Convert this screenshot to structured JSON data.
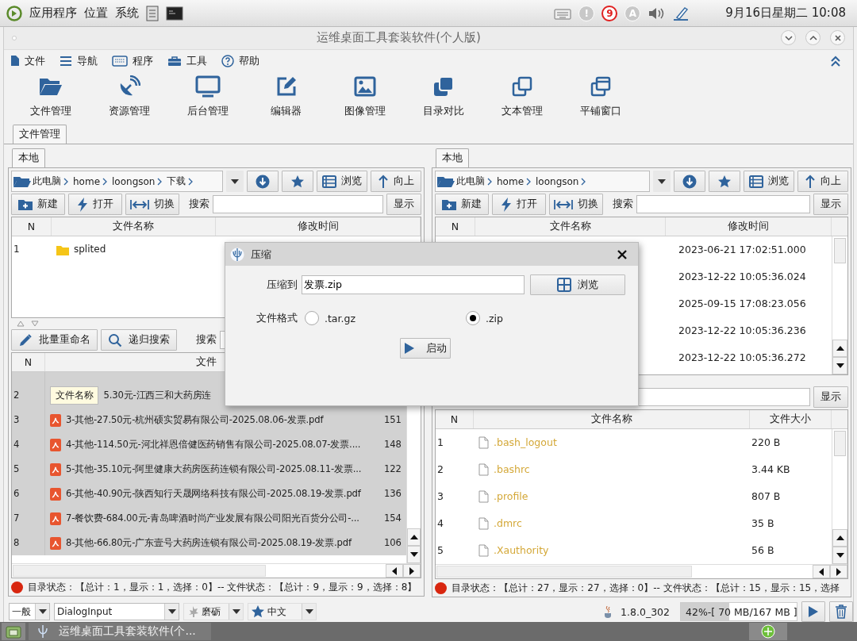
{
  "system_bar": {
    "menus": [
      "应用程序",
      "位置",
      "系统"
    ],
    "tray": [
      {
        "kind": "alert",
        "text": "!"
      },
      {
        "kind": "count",
        "text": "9"
      },
      {
        "kind": "letter",
        "text": "A"
      }
    ],
    "clock": "9月16日星期二 10:08"
  },
  "window": {
    "title": "运维桌面工具套装软件(个人版)"
  },
  "menu": [
    "文件",
    "导航",
    "程序",
    "工具",
    "帮助"
  ],
  "toolbar": [
    "文件管理",
    "资源管理",
    "后台管理",
    "编辑器",
    "图像管理",
    "目录对比",
    "文本管理",
    "平铺窗口"
  ],
  "tabs": [
    {
      "label": "文件管理",
      "selected": true
    }
  ],
  "panels": [
    {
      "tabs": [
        {
          "label": "本地",
          "selected": true
        }
      ],
      "path": [
        "此电脑",
        "home",
        "loongson",
        "下载"
      ],
      "browse": "浏览",
      "up": "向上",
      "actions": [
        "新建",
        "打开",
        "切换"
      ],
      "search_label": "搜索",
      "show": "显示",
      "dir_table": {
        "columns": [
          "N",
          "文件名称",
          "修改时间"
        ],
        "rows": [
          {
            "n": "1",
            "name": "splited",
            "selected": false
          }
        ]
      },
      "file_toolbar": {
        "actions": [
          "批量重命名",
          "递归搜索"
        ],
        "search_label": "搜索"
      },
      "file_table": {
        "columns": [
          "N",
          "文件"
        ],
        "rows": [
          {
            "selected": true
          },
          {
            "n": "2",
            "tooltip": "文件名称",
            "name": "5.30元-江西三和大药房连",
            "selected": true
          },
          {
            "n": "3",
            "name": "3-其他-27.50元-杭州硕实贸易有限公司-2025.08.06-发票.pdf",
            "size": "151",
            "selected": true
          },
          {
            "n": "4",
            "name": "4-其他-114.50元-河北祥恩倍健医药销售有限公司-2025.08.07-发票....",
            "size": "148",
            "selected": true
          },
          {
            "n": "5",
            "name": "5-其他-35.10元-阿里健康大药房医药连锁有限公司-2025.08.11-发票...",
            "size": "122",
            "selected": true
          },
          {
            "n": "6",
            "name": "6-其他-40.90元-陕西知行天晟网络科技有限公司-2025.08.19-发票.pdf",
            "size": "136",
            "selected": true
          },
          {
            "n": "7",
            "name": "7-餐饮费-684.00元-青岛啤酒时尚产业发展有限公司阳光百货分公司-...",
            "size": "154",
            "selected": true
          },
          {
            "n": "8",
            "name": "8-其他-66.80元-广东壹号大药房连锁有限公司-2025.08.19-发票.pdf",
            "size": "106",
            "selected": true
          }
        ]
      },
      "status": "目录状态：【总计：1，显示：1，选择：0】-- 文件状态：【总计：9，显示：9，选择：8】"
    },
    {
      "tabs": [
        {
          "label": "本地",
          "selected": true
        }
      ],
      "path": [
        "此电脑",
        "home",
        "loongson"
      ],
      "browse": "浏览",
      "up": "向上",
      "actions": [
        "新建",
        "打开",
        "切换"
      ],
      "search_label": "搜索",
      "show": "显示",
      "dir_table": {
        "columns": [
          "N",
          "文件名称",
          "修改时间"
        ],
        "rows": [
          {
            "modified": "2023-06-21 17:02:51.000",
            "selected": false
          },
          {
            "modified": "2023-12-22 10:05:36.024",
            "selected": false
          },
          {
            "modified": "2025-09-15 17:08:23.056",
            "selected": false
          },
          {
            "modified": "2023-12-22 10:05:36.236",
            "selected": false
          },
          {
            "modified": "2023-12-22 10:05:36.272",
            "selected": false
          }
        ]
      },
      "file_toolbar": {
        "show": "显示"
      },
      "file_table": {
        "columns": [
          "N",
          "文件名称",
          "文件大小"
        ],
        "rows": [
          {
            "n": "1",
            "name": ".bash_logout",
            "size": "220 B",
            "selected": false
          },
          {
            "n": "2",
            "name": ".bashrc",
            "size": "3.44 KB",
            "selected": false
          },
          {
            "n": "3",
            "name": ".profile",
            "size": "807 B",
            "selected": false
          },
          {
            "n": "4",
            "name": ".dmrc",
            "size": "35 B",
            "selected": false
          },
          {
            "n": "5",
            "name": ".Xauthority",
            "size": "56 B",
            "selected": false
          }
        ]
      },
      "status": "目录状态：【总计：27，显示：27，选择：0】-- 文件状态：【总计：15，显示：15，选择"
    }
  ],
  "dialog": {
    "title": "压缩",
    "target_label": "压缩到",
    "target_value": "发票.zip",
    "browse": "浏览",
    "format_label": "文件格式",
    "formats": [
      {
        "label": ".tar.gz",
        "selected": false
      },
      {
        "label": ".zip",
        "selected": true
      }
    ],
    "start": "启动"
  },
  "bottom_bar": {
    "category": "一般",
    "font": "DialogInput",
    "theme": "磨砺",
    "language": "中文",
    "java_version": "1.8.0_302",
    "memory": {
      "text": "42%-[ 70 MB/167 MB ]",
      "level": 0.42
    }
  },
  "taskbar": {
    "title": "运维桌面工具套装软件(个..."
  }
}
